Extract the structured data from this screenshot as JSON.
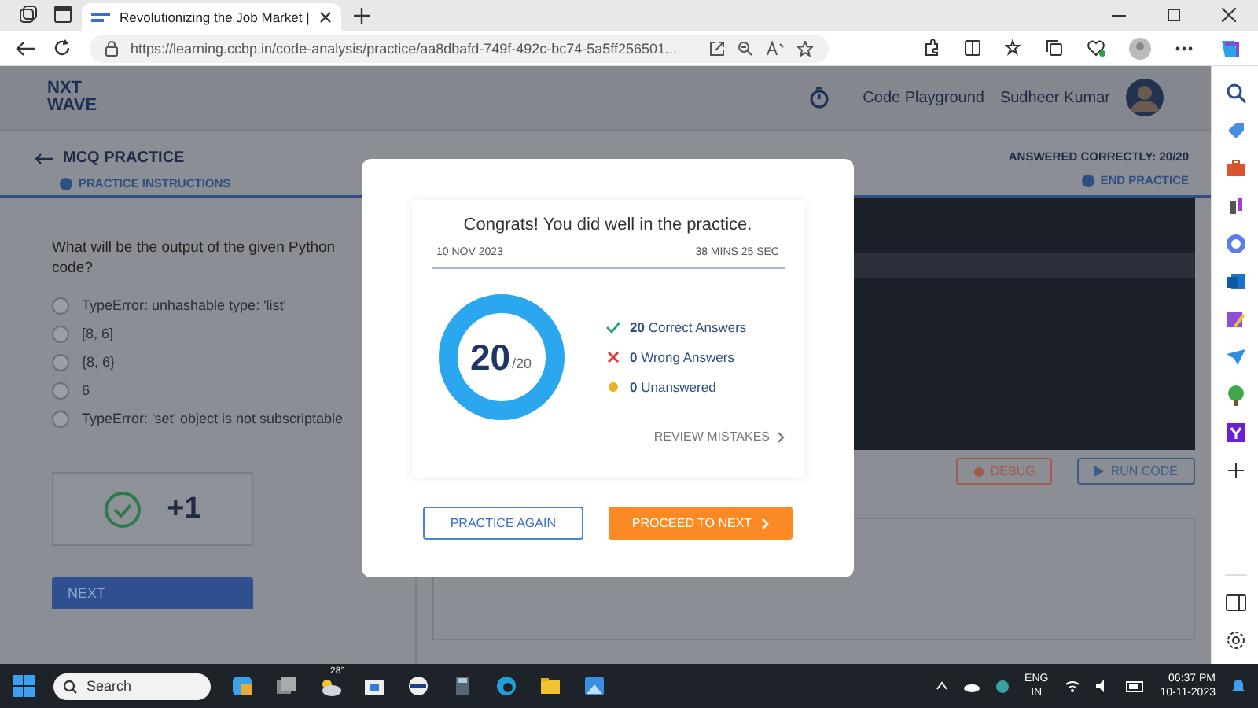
{
  "browser": {
    "tabs": [
      {
        "title": "Revolutionizing the Job Market |",
        "selected": true
      }
    ],
    "url": "https://learning.ccbp.in/code-analysis/practice/aa8dbafd-749f-492c-bc74-5a5ff256501..."
  },
  "header": {
    "logo_top": "NXT",
    "logo_bottom": "WAVE",
    "nav_link": "Code Playground",
    "user_name": "Sudheer Kumar"
  },
  "practice_bar": {
    "title": "MCQ PRACTICE",
    "instructions": "PRACTICE INSTRUCTIONS",
    "answered": "ANSWERED CORRECTLY: 20/20",
    "end": "END PRACTICE"
  },
  "question": {
    "text": "What will be the output of the given Python code?",
    "options": [
      {
        "label": "TypeError: unhashable type: 'list'",
        "selected": false
      },
      {
        "label": "[8, 6]",
        "selected": false
      },
      {
        "label": "{8, 6}",
        "selected": false
      },
      {
        "label": "6",
        "selected": false
      },
      {
        "label": "TypeError: 'set' object is not subscriptable",
        "selected": false
      }
    ],
    "result": "+1",
    "next": "NEXT"
  },
  "editor": {
    "buttons": [
      {
        "kind": "debug",
        "label": "DEBUG"
      },
      {
        "kind": "run",
        "label": "RUN CODE"
      }
    ]
  },
  "modal": {
    "title": "Congrats! You did well in the practice.",
    "date": "10 NOV 2023",
    "duration": "38 MINS 25 SEC",
    "score": "20",
    "total": "/20",
    "level": 1,
    "stats": [
      {
        "kind": "correct",
        "text": "**20** Correct Answers"
      },
      {
        "kind": "wrong",
        "text": "**0** Wrong Answers"
      },
      {
        "kind": "unanswered",
        "text": "**0** Unanswered"
      }
    ],
    "review": "REVIEW MISTAKES",
    "practice_again": "PRACTICE AGAIN",
    "proceed": "PROCEED TO NEXT"
  },
  "taskbar": {
    "search": "Search",
    "weather": "28°",
    "lang": "ENG",
    "region": "IN",
    "time": "06:37 PM",
    "date": "10-11-2023"
  }
}
